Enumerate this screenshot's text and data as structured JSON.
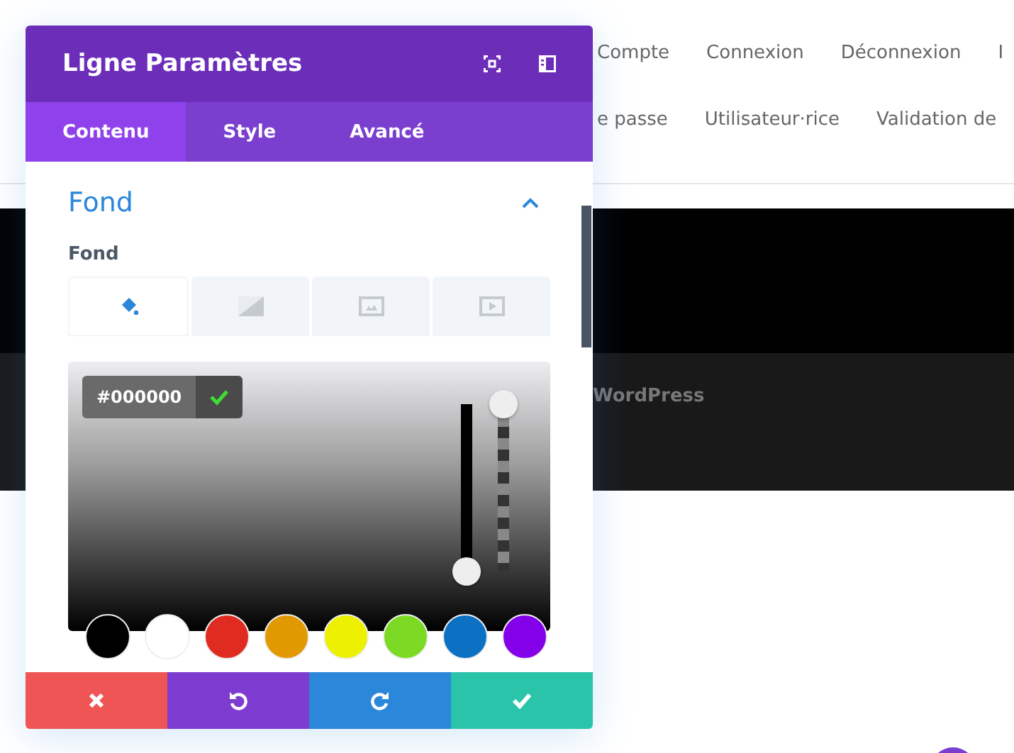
{
  "page": {
    "nav_rows": [
      [
        "Compte",
        "Connexion",
        "Déconnexion",
        "I"
      ],
      [
        "e passe",
        "Utilisateur·rice",
        "Validation de"
      ]
    ],
    "banner_text": "WordPress"
  },
  "panel": {
    "title": "Ligne Paramètres",
    "tabs": [
      {
        "label": "Contenu",
        "selected": true
      },
      {
        "label": "Style",
        "selected": false
      },
      {
        "label": "Avancé",
        "selected": false
      }
    ],
    "section": {
      "title": "Fond",
      "expanded": true,
      "field_label": "Fond",
      "background_types": [
        {
          "kind": "color",
          "selected": true
        },
        {
          "kind": "gradient",
          "selected": false
        },
        {
          "kind": "image",
          "selected": false
        },
        {
          "kind": "video",
          "selected": false
        }
      ],
      "picker": {
        "hex_value": "#000000",
        "sliders": [
          {
            "kind": "shade",
            "level": 0
          },
          {
            "kind": "opacity",
            "level": 1
          }
        ],
        "swatches": [
          {
            "color": "#000000"
          },
          {
            "color": "#ffffff"
          },
          {
            "color": "#e02b20"
          },
          {
            "color": "#e09900"
          },
          {
            "color": "#edf000"
          },
          {
            "color": "#7cda24"
          },
          {
            "color": "#0c71c3"
          },
          {
            "color": "#8300e9"
          }
        ]
      }
    },
    "actions": [
      {
        "kind": "cancel"
      },
      {
        "kind": "undo"
      },
      {
        "kind": "redo"
      },
      {
        "kind": "save"
      }
    ]
  }
}
